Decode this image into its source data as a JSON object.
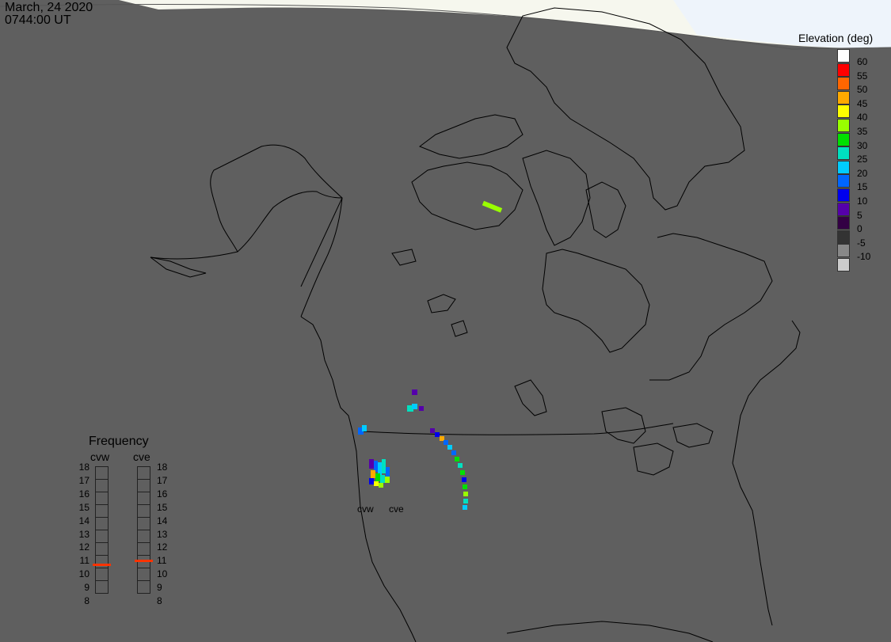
{
  "header": {
    "date": "March, 24 2020",
    "time": "0744:00 UT"
  },
  "elevation_legend": {
    "title": "Elevation (deg)",
    "entries": [
      {
        "label": "60",
        "color": "#ffffff"
      },
      {
        "label": "55",
        "color": "#ff0000"
      },
      {
        "label": "50",
        "color": "#ff6600"
      },
      {
        "label": "45",
        "color": "#ffaa00"
      },
      {
        "label": "40",
        "color": "#ffff00"
      },
      {
        "label": "35",
        "color": "#99ff00"
      },
      {
        "label": "30",
        "color": "#00e000"
      },
      {
        "label": "25",
        "color": "#00e0c0"
      },
      {
        "label": "20",
        "color": "#00ccff"
      },
      {
        "label": "15",
        "color": "#0066ff"
      },
      {
        "label": "10",
        "color": "#0000ee"
      },
      {
        "label": "5",
        "color": "#5500aa"
      },
      {
        "label": "0",
        "color": "#330044"
      },
      {
        "label": "-5",
        "color": "#333333"
      },
      {
        "label": "-10",
        "color": "#888888"
      },
      {
        "label": "",
        "color": "#cccccc"
      }
    ]
  },
  "frequency": {
    "title": "Frequency",
    "radars": [
      {
        "name": "cvw",
        "value": 10.8
      },
      {
        "name": "cve",
        "value": 11.1
      }
    ],
    "scale": [
      "18",
      "17",
      "16",
      "15",
      "14",
      "13",
      "12",
      "11",
      "10",
      "9",
      "8"
    ]
  },
  "radar_labels": [
    "cvw",
    "cve"
  ],
  "colors": {
    "ocean": "#5f5f5f",
    "daylight": "#f8f8f0",
    "coast": "#000000"
  }
}
